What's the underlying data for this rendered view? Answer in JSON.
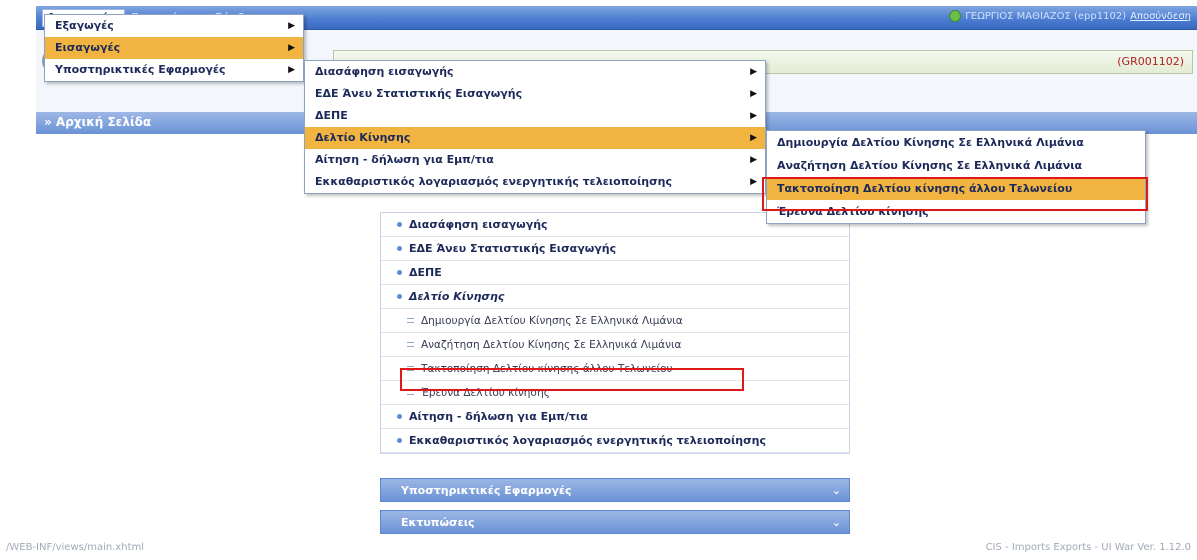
{
  "topbar": {
    "menu": [
      "Λειτουργίες",
      "Εκτυπώσεις",
      "Σύνδεσμοι"
    ],
    "user": "ΓΕΩΡΓΙΟΣ ΜΑΘΙΑΖΟΣ (epp1102)",
    "logout": "Αποσύνδεση"
  },
  "code": "(GR001102)",
  "home_title": "» Αρχική Σελίδα",
  "menu1": [
    "Εξαγωγές",
    "Εισαγωγές",
    "Υποστηρικτικές Εφαρμογές"
  ],
  "menu2": [
    "Διασάφηση εισαγωγής",
    "ΕΔΕ Άνευ Στατιστικής Εισαγωγής",
    "ΔΕΠΕ",
    "Δελτίο Κίνησης",
    "Αίτηση - δήλωση για Εμπ/τια",
    "Εκκαθαριστικός λογαριασμός ενεργητικής τελειοποίησης"
  ],
  "menu3": [
    "Δημιουργία Δελτίου Κίνησης Σε Ελληνικά Λιμάνια",
    "Αναζήτηση Δελτίου Κίνησης Σε Ελληνικά Λιμάνια",
    "Τακτοποίηση Δελτίου κίνησης άλλου Τελωνείου",
    "Έρευνα Δελτίου κίνησης"
  ],
  "panel": [
    {
      "label": "Διασάφηση εισαγωγής",
      "type": "main"
    },
    {
      "label": "ΕΔΕ Άνευ Στατιστικής Εισαγωγής",
      "type": "main"
    },
    {
      "label": "ΔΕΠΕ",
      "type": "main"
    },
    {
      "label": "Δελτίο Κίνησης",
      "type": "main-italic"
    },
    {
      "label": "Δημιουργία Δελτίου Κίνησης Σε Ελληνικά Λιμάνια",
      "type": "sub"
    },
    {
      "label": "Αναζήτηση Δελτίου Κίνησης Σε Ελληνικά Λιμάνια",
      "type": "sub"
    },
    {
      "label": "Τακτοποίηση Δελτίου κίνησης άλλου Τελωνείου",
      "type": "sub"
    },
    {
      "label": "Έρευνα Δελτίου κίνησης",
      "type": "sub"
    },
    {
      "label": "Αίτηση - δήλωση για Εμπ/τια",
      "type": "main"
    },
    {
      "label": "Εκκαθαριστικός λογαριασμός ενεργητικής τελειοποίησης",
      "type": "main"
    }
  ],
  "accordions": [
    "Υποστηρικτικές Εφαρμογές",
    "Εκτυπώσεις"
  ],
  "footer": {
    "left": "/WEB-INF/views/main.xhtml",
    "right": "CIS - Imports Exports - UI War Ver. 1.12.0"
  },
  "colors": {
    "highlight": "#f2b441",
    "redbox": "#e01818",
    "menubar": "#4a7bd0"
  }
}
